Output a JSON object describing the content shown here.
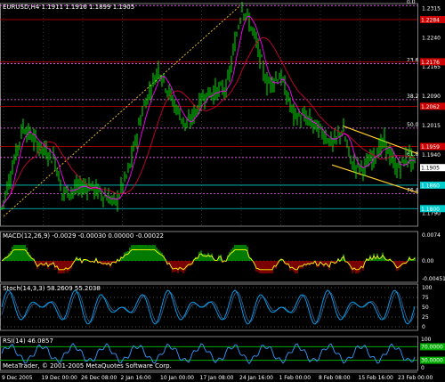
{
  "main": {
    "title": "EURUSD,H4  1.1911 1.1916 1.1899 1.1905",
    "price_axis": [
      "1.2315",
      "1.2240",
      "1.2165",
      "1.2090",
      "1.2015",
      "1.1940",
      "1.1865",
      "1.1790"
    ],
    "fib_levels": [
      {
        "label": "0.0",
        "price": 1.232
      },
      {
        "label": "23.6",
        "price": 1.2171
      },
      {
        "label": "38.2",
        "price": 1.2079
      },
      {
        "label": "50.0",
        "price": 1.2006
      },
      {
        "label": "61.8",
        "price": 1.1931
      },
      {
        "label": "76.4",
        "price": 1.1838
      }
    ],
    "price_tags": [
      {
        "text": "1.2284",
        "price": 1.2284,
        "color": "#cc0000"
      },
      {
        "text": "1.2176",
        "price": 1.2176,
        "color": "#cc0000"
      },
      {
        "text": "1.2062",
        "price": 1.2062,
        "color": "#cc0000"
      },
      {
        "text": "1.1959",
        "price": 1.1959,
        "color": "#cc0000"
      },
      {
        "text": "1.1905",
        "price": 1.1905,
        "color": "#ffffff"
      },
      {
        "text": "1.1860",
        "price": 1.186,
        "color": "#00cccc"
      },
      {
        "text": "1.1800",
        "price": 1.18,
        "color": "#00cccc"
      }
    ]
  },
  "macd": {
    "label": "MACD(12,26,9) -0.0029 -0.00030 0.00000 -0.00022",
    "axis": [
      "0.0074",
      "0.00",
      "-0.00451"
    ]
  },
  "stoch": {
    "label": "Stoch(14,3,3) 58.2609 55.2038",
    "axis": [
      "100",
      "75",
      "50",
      "25",
      "0"
    ]
  },
  "rsi": {
    "label": "RSI(14) 46.0857",
    "axis": [
      "100",
      "70.0000",
      "30.0000",
      "0"
    ],
    "copyright": "MetaTrader, © 2001-2005 MetaQuotes Software Corp."
  },
  "time_axis": [
    "9 Dec 2005",
    "19 Dec 00:00",
    "26 Dec 08:00",
    "2 Jan 16:00",
    "10 Jan 00:00",
    "17 Jan 08:00",
    "24 Jan 16:00",
    "1 Feb 00:00",
    "8 Feb 08:00",
    "15 Feb 16:00",
    "23 Feb 00:00"
  ],
  "colors": {
    "background": "#000000",
    "grid": "#808080",
    "bull": "#00ff00",
    "fib": "#ff66ff",
    "resistance": "#cc0000",
    "support": "#00cccc",
    "ma_fast": "#ff00ff",
    "ma_slow": "#cc0033",
    "channel": "#ffcc33",
    "macd_signal": "#ffff00",
    "stoch_line": "#00aaff",
    "rsi_line": "#3399ff"
  }
}
